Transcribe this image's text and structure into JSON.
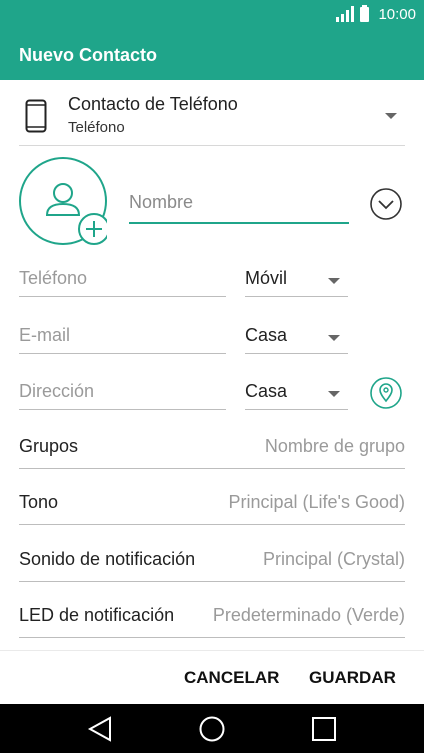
{
  "status_bar": {
    "time": "10:00"
  },
  "app_bar": {
    "title": "Nuevo Contacto"
  },
  "account": {
    "title": "Contacto de Teléfono",
    "subtitle": "Teléfono"
  },
  "name_field": {
    "placeholder": "Nombre",
    "value": ""
  },
  "fields": [
    {
      "placeholder": "Teléfono",
      "type": "Móvil"
    },
    {
      "placeholder": "E-mail",
      "type": "Casa"
    },
    {
      "placeholder": "Dirección",
      "type": "Casa"
    }
  ],
  "settings": [
    {
      "label": "Grupos",
      "value": "Nombre de grupo"
    },
    {
      "label": "Tono",
      "value": "Principal (Life's Good)"
    },
    {
      "label": "Sonido de notificación",
      "value": "Principal (Crystal)"
    },
    {
      "label": "LED de notificación",
      "value": "Predeterminado (Verde)"
    }
  ],
  "actions": {
    "cancel": "CANCELAR",
    "save": "GUARDAR"
  },
  "colors": {
    "accent": "#1fa58a"
  }
}
